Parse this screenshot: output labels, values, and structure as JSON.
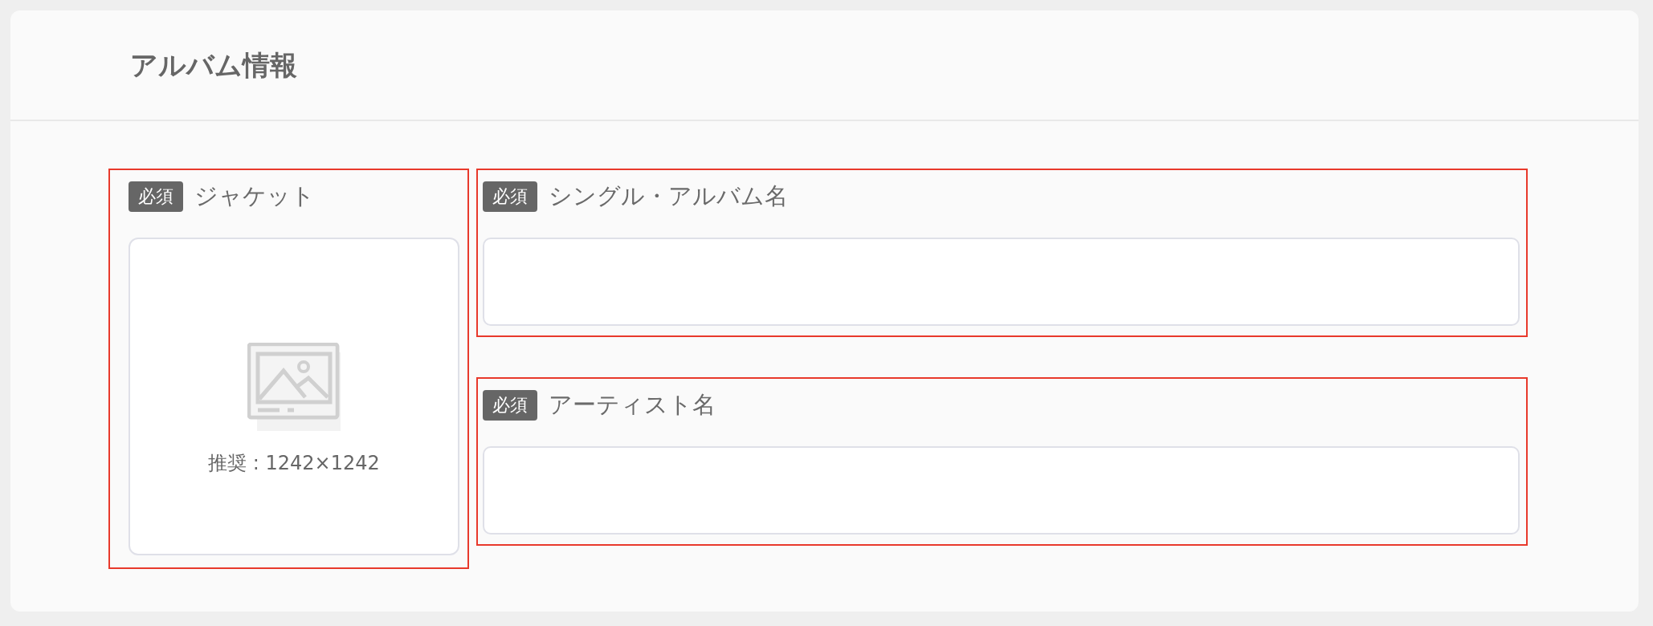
{
  "section": {
    "title": "アルバム情報"
  },
  "jacket": {
    "badge": "必須",
    "label": "ジャケット",
    "highlighted": true,
    "hint": "推奨 : 1242×1242"
  },
  "fields": [
    {
      "badge": "必須",
      "label": "シングル・アルバム名",
      "highlighted": true
    },
    {
      "badge": "必須",
      "label": "アーティスト名",
      "highlighted": true
    }
  ]
}
